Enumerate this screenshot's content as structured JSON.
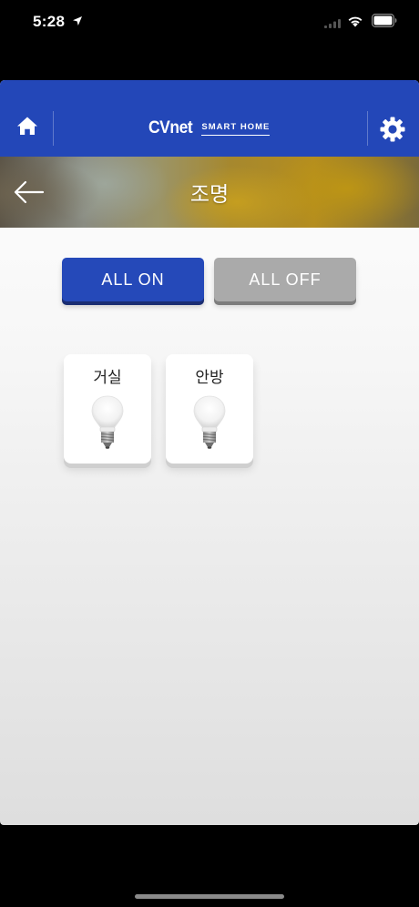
{
  "status_bar": {
    "time": "5:28"
  },
  "header": {
    "brand": "CVnet",
    "brand_sub": "SMART HOME"
  },
  "page": {
    "title": "조명"
  },
  "actions": {
    "all_on_label": "ALL ON",
    "all_off_label": "ALL OFF"
  },
  "lights": [
    {
      "name": "거실",
      "icon": "lightbulb-icon"
    },
    {
      "name": "안방",
      "icon": "lightbulb-icon"
    }
  ],
  "colors": {
    "header_blue": "#2347b8",
    "all_on": "#2549b9",
    "all_off": "#aaaaaa"
  }
}
